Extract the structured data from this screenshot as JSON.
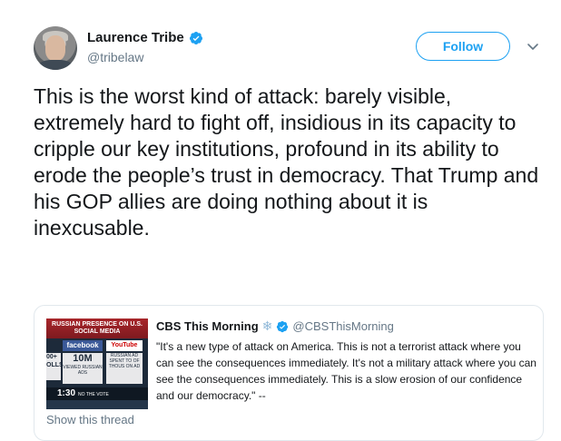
{
  "author": {
    "display_name": "Laurence Tribe",
    "handle": "@tribelaw",
    "verified_icon": "verified-badge-icon",
    "avatar": "profile-photo"
  },
  "actions": {
    "follow_label": "Follow",
    "more_icon": "chevron-down-icon"
  },
  "tweet": {
    "text": "This is the worst kind of attack: barely visible, extremely hard to fight off, insidious in its capacity to cripple our key institutions, profound in its ability to erode the people’s trust in democracy. That Trump and his GOP allies are doing nothing about it is inexcusable."
  },
  "quote": {
    "display_name": "CBS This Morning",
    "name_emoji": "❄",
    "handle": "@CBSThisMorning",
    "text": "\"It's a new type of attack on America. This is not a terrorist attack where you can see the consequences immediately. It's not a military attack where you can see the consequences immediately. This is a slow erosion of our confidence and our democracy.\" --",
    "show_thread": "Show this thread",
    "thumbnail": {
      "banner": "RUSSIAN PRESENCE ON U.S. SOCIAL MEDIA",
      "facebook": "facebook",
      "youtube": "YouTube",
      "left_panel": "00+ OLLS",
      "stat_big": "10M",
      "stat_small": "VIEWED RUSSIAN ADS",
      "right_panel": "RUSSIAN AD SPENT TO OF THOUS ON AD",
      "clock": "1:30",
      "clock_sub": "NO THE VOTE"
    }
  },
  "colors": {
    "accent": "#1da1f2",
    "text": "#14171a",
    "muted": "#657786",
    "border": "#e1e8ed"
  }
}
